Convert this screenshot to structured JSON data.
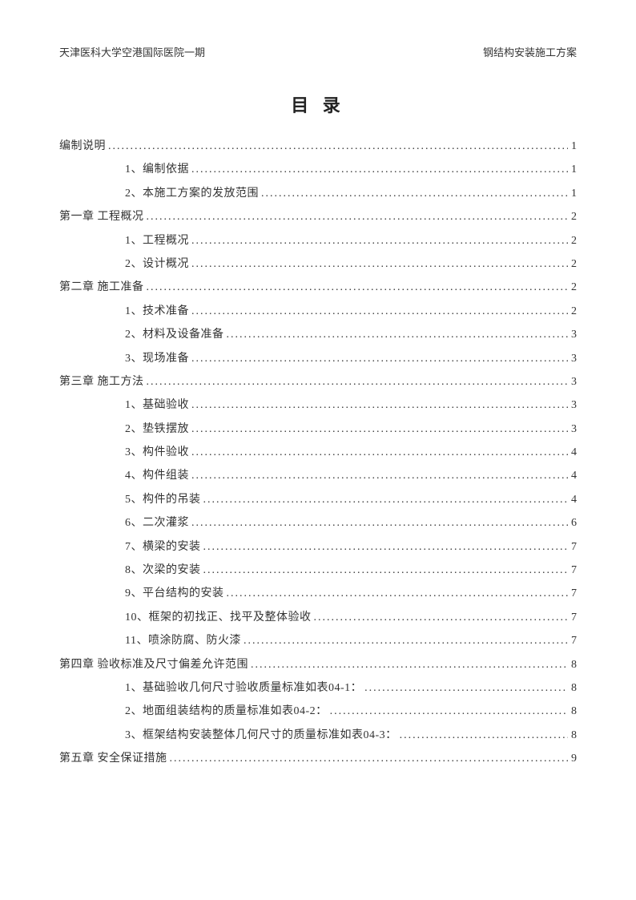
{
  "header": {
    "left": "天津医科大学空港国际医院一期",
    "right": "钢结构安装施工方案"
  },
  "title": "目 录",
  "toc": [
    {
      "level": 0,
      "label": "编制说明",
      "page": "1"
    },
    {
      "level": 1,
      "label": "1、编制依据",
      "page": "1"
    },
    {
      "level": 1,
      "label": "2、本施工方案的发放范围",
      "page": "1"
    },
    {
      "level": 0,
      "label": "第一章 工程概况",
      "page": "2"
    },
    {
      "level": 1,
      "label": "1、工程概况",
      "page": "2"
    },
    {
      "level": 1,
      "label": "2、设计概况",
      "page": "2"
    },
    {
      "level": 0,
      "label": "第二章 施工准备",
      "page": "2"
    },
    {
      "level": 1,
      "label": "1、技术准备",
      "page": "2"
    },
    {
      "level": 1,
      "label": "2、材料及设备准备",
      "page": "3"
    },
    {
      "level": 1,
      "label": "3、现场准备",
      "page": "3"
    },
    {
      "level": 0,
      "label": "第三章  施工方法",
      "page": "3"
    },
    {
      "level": 1,
      "label": "1、基础验收",
      "page": "3"
    },
    {
      "level": 1,
      "label": "2、垫铁摆放",
      "page": "3"
    },
    {
      "level": 1,
      "label": "3、构件验收",
      "page": "4"
    },
    {
      "level": 1,
      "label": "4、构件组装",
      "page": "4"
    },
    {
      "level": 1,
      "label": "5、构件的吊装",
      "page": "4"
    },
    {
      "level": 1,
      "label": "6、二次灌浆",
      "page": "6"
    },
    {
      "level": 1,
      "label": "7、横梁的安装",
      "page": "7"
    },
    {
      "level": 1,
      "label": "8、次梁的安装",
      "page": "7"
    },
    {
      "level": 1,
      "label": "9、平台结构的安装",
      "page": "7"
    },
    {
      "level": 1,
      "label": "10、框架的初找正、找平及整体验收",
      "page": "7"
    },
    {
      "level": 1,
      "label": "11、喷涂防腐、防火漆",
      "page": "7"
    },
    {
      "level": 0,
      "label": "第四章 验收标准及尺寸偏差允许范围",
      "page": "8"
    },
    {
      "level": 1,
      "label": "1、基础验收几何尺寸验收质量标准如表04-1：",
      "page": "8"
    },
    {
      "level": 1,
      "label": "2、地面组装结构的质量标准如表04-2：",
      "page": "8"
    },
    {
      "level": 1,
      "label": "3、框架结构安装整体几何尺寸的质量标准如表04-3：",
      "page": "8"
    },
    {
      "level": 0,
      "label": "第五章 安全保证措施",
      "page": "9"
    }
  ]
}
